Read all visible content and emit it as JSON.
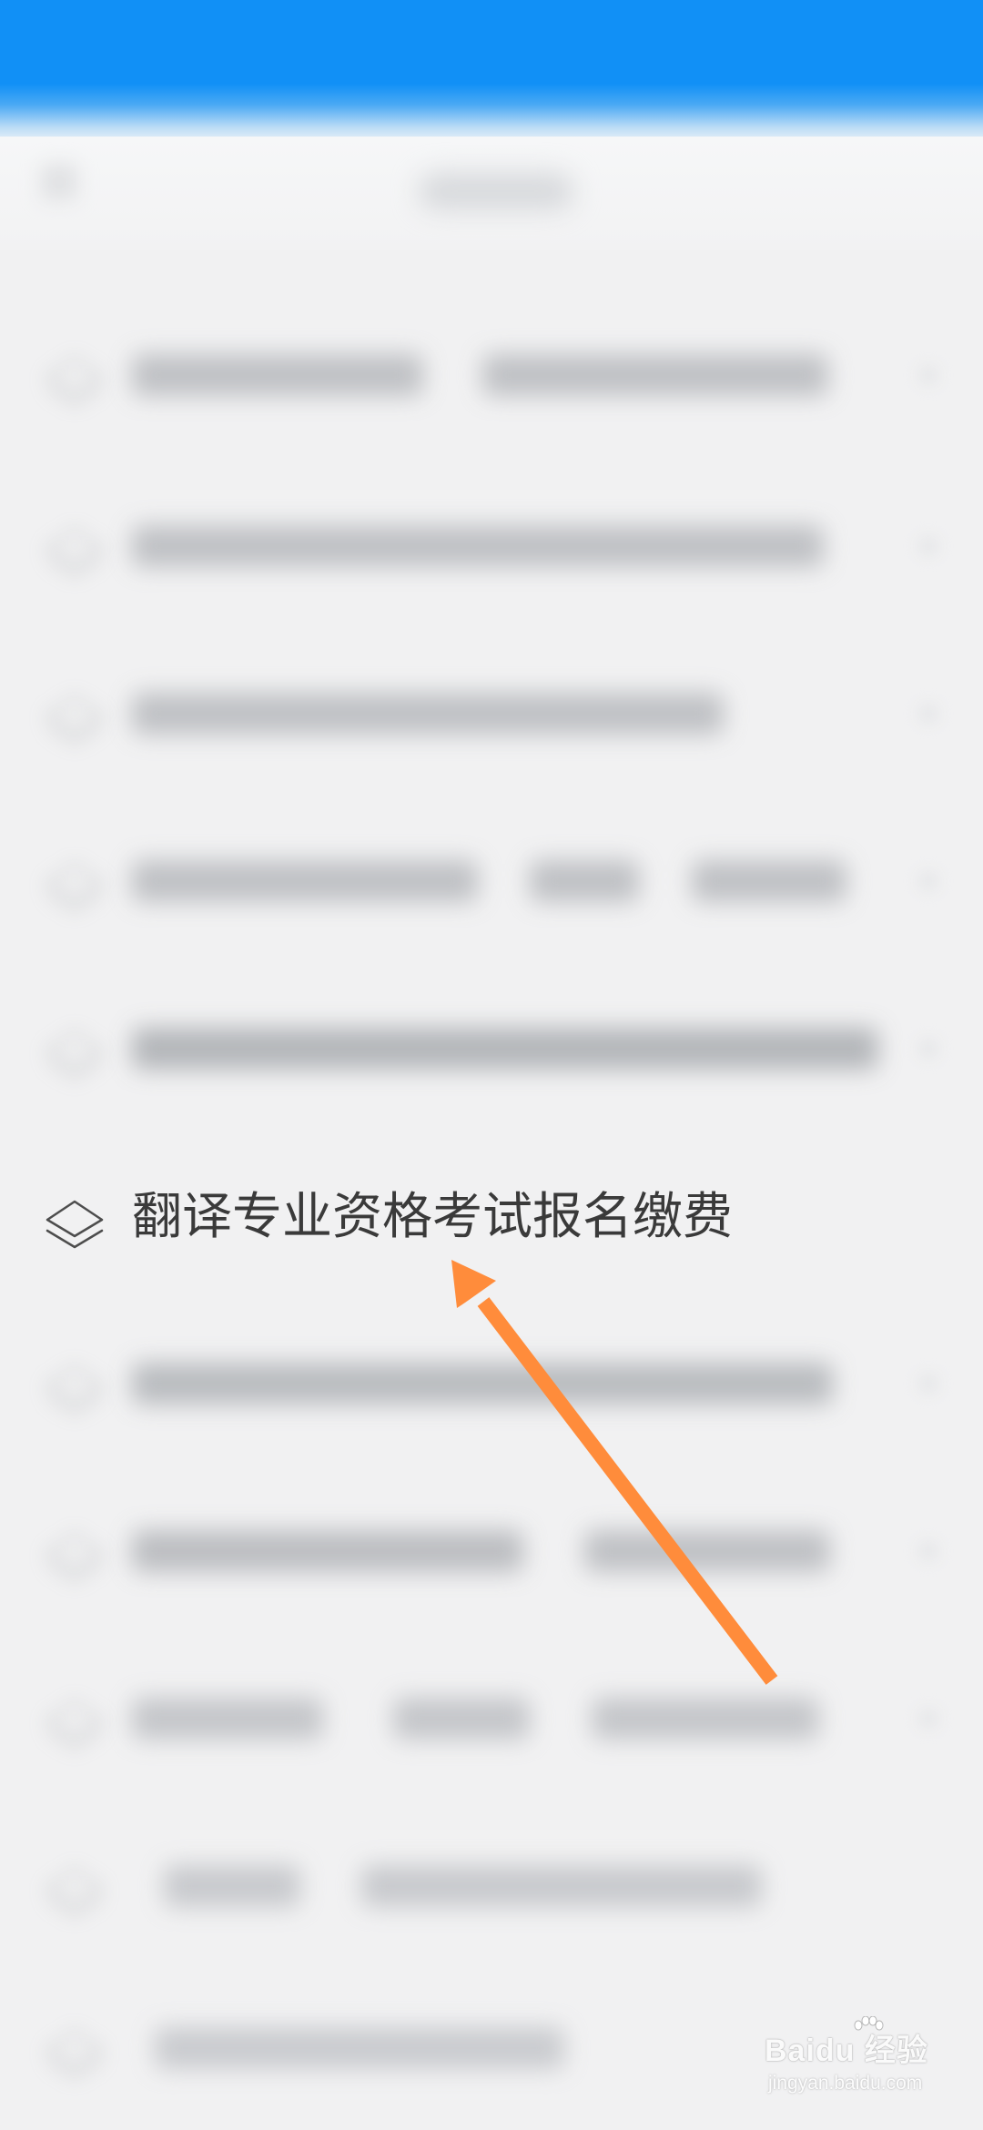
{
  "header": {
    "title": ""
  },
  "menu": {
    "items": [
      {
        "label": "翻译专业资格考试报名缴费",
        "icon": "layers-icon",
        "highlighted": true
      }
    ]
  },
  "annotation": {
    "arrow_color": "#ff8c3b"
  },
  "watermark": {
    "main": "Baidu 经验",
    "sub": "jingyan.baidu.com"
  },
  "colors": {
    "header_blue": "#1190f6",
    "background": "#f1f1f2",
    "text": "#3a3a3a"
  }
}
